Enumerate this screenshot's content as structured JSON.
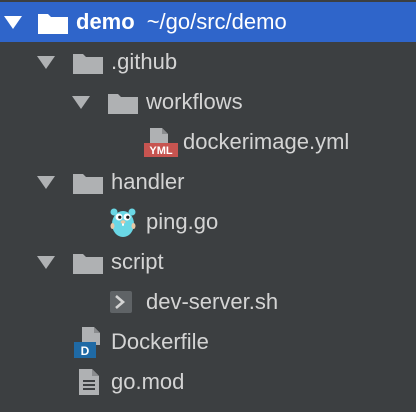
{
  "project_tree": {
    "root": {
      "name": "demo",
      "path": "~/go/src/demo"
    },
    "items": [
      {
        "label": ".github"
      },
      {
        "label": "workflows"
      },
      {
        "label": "dockerimage.yml",
        "badge": "YML"
      },
      {
        "label": "handler"
      },
      {
        "label": "ping.go"
      },
      {
        "label": "script"
      },
      {
        "label": "dev-server.sh"
      },
      {
        "label": "Dockerfile",
        "badge": "D"
      },
      {
        "label": "go.mod"
      }
    ]
  },
  "colors": {
    "background": "#3c3f41",
    "selection": "#2f65ca",
    "folder": "#afb1b3",
    "text": "#d4d4d4",
    "yml_badge": "#c75450",
    "docker_badge": "#1f6aa5",
    "gopher": "#6ad7e5"
  }
}
